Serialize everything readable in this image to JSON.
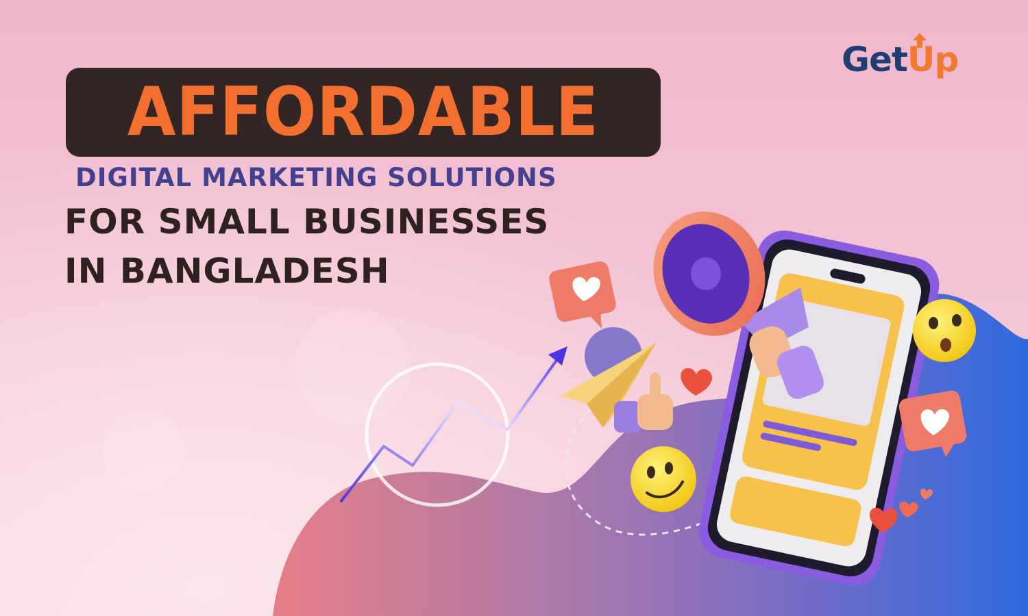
{
  "brand": {
    "name_part1": "Get",
    "name_part2": "Up",
    "accent_color": "#f07a2e",
    "dark_color": "#1f3f73"
  },
  "headline": {
    "highlight": "AFFORDABLE",
    "line1": "DIGITAL MARKETING SOLUTIONS",
    "line2": "FOR SMALL BUSINESSES",
    "line3": "IN BANGLADESH"
  },
  "colors": {
    "highlight_text": "#f26f2f",
    "highlight_box": "#332524",
    "line1_color": "#43408f",
    "body_text": "#2e2221"
  },
  "illustration": {
    "icons": [
      "megaphone-icon",
      "smartphone-icon",
      "heart-badge-icon",
      "paper-plane-icon",
      "thumbs-up-icon",
      "surprised-emoji-icon",
      "smiling-emoji-icon",
      "growth-arrow-icon",
      "heart-icon"
    ]
  }
}
